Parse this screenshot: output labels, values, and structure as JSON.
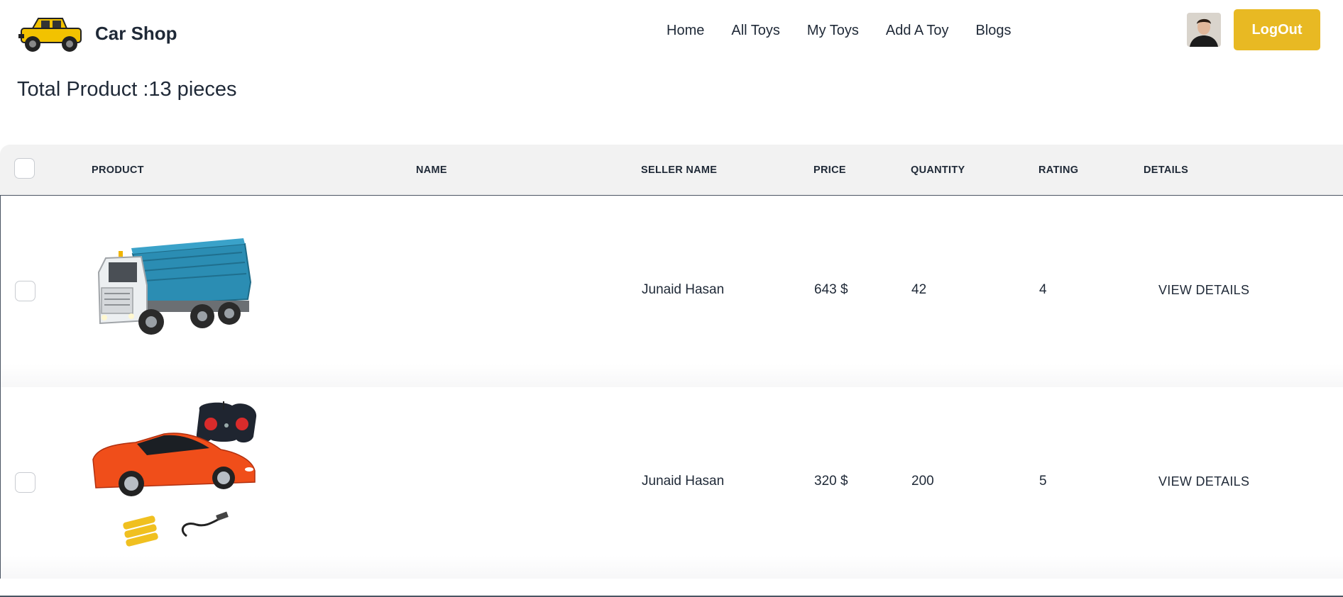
{
  "navbar": {
    "brand": "Car Shop",
    "links": [
      "Home",
      "All Toys",
      "My Toys",
      "Add A Toy",
      "Blogs"
    ],
    "logout_label": "LogOut"
  },
  "page": {
    "title": "Total Product :13 pieces"
  },
  "table": {
    "headers": [
      "PRODUCT",
      "NAME",
      "SELLER NAME",
      "PRICE",
      "QUANTITY",
      "RATING",
      "DETAILS"
    ],
    "rows": [
      {
        "product_icon": "dump-truck-image",
        "name": "",
        "seller": "Junaid Hasan",
        "price": "643 $",
        "quantity": "42",
        "rating": "4",
        "details": "VIEW DETAILS"
      },
      {
        "product_icon": "rc-sports-car-image",
        "name": "",
        "seller": "Junaid Hasan",
        "price": "320 $",
        "quantity": "200",
        "rating": "5",
        "details": "VIEW DETAILS"
      }
    ]
  },
  "colors": {
    "accent": "#e8b923",
    "header_bg": "#f2f2f2",
    "text": "#1f2937"
  }
}
